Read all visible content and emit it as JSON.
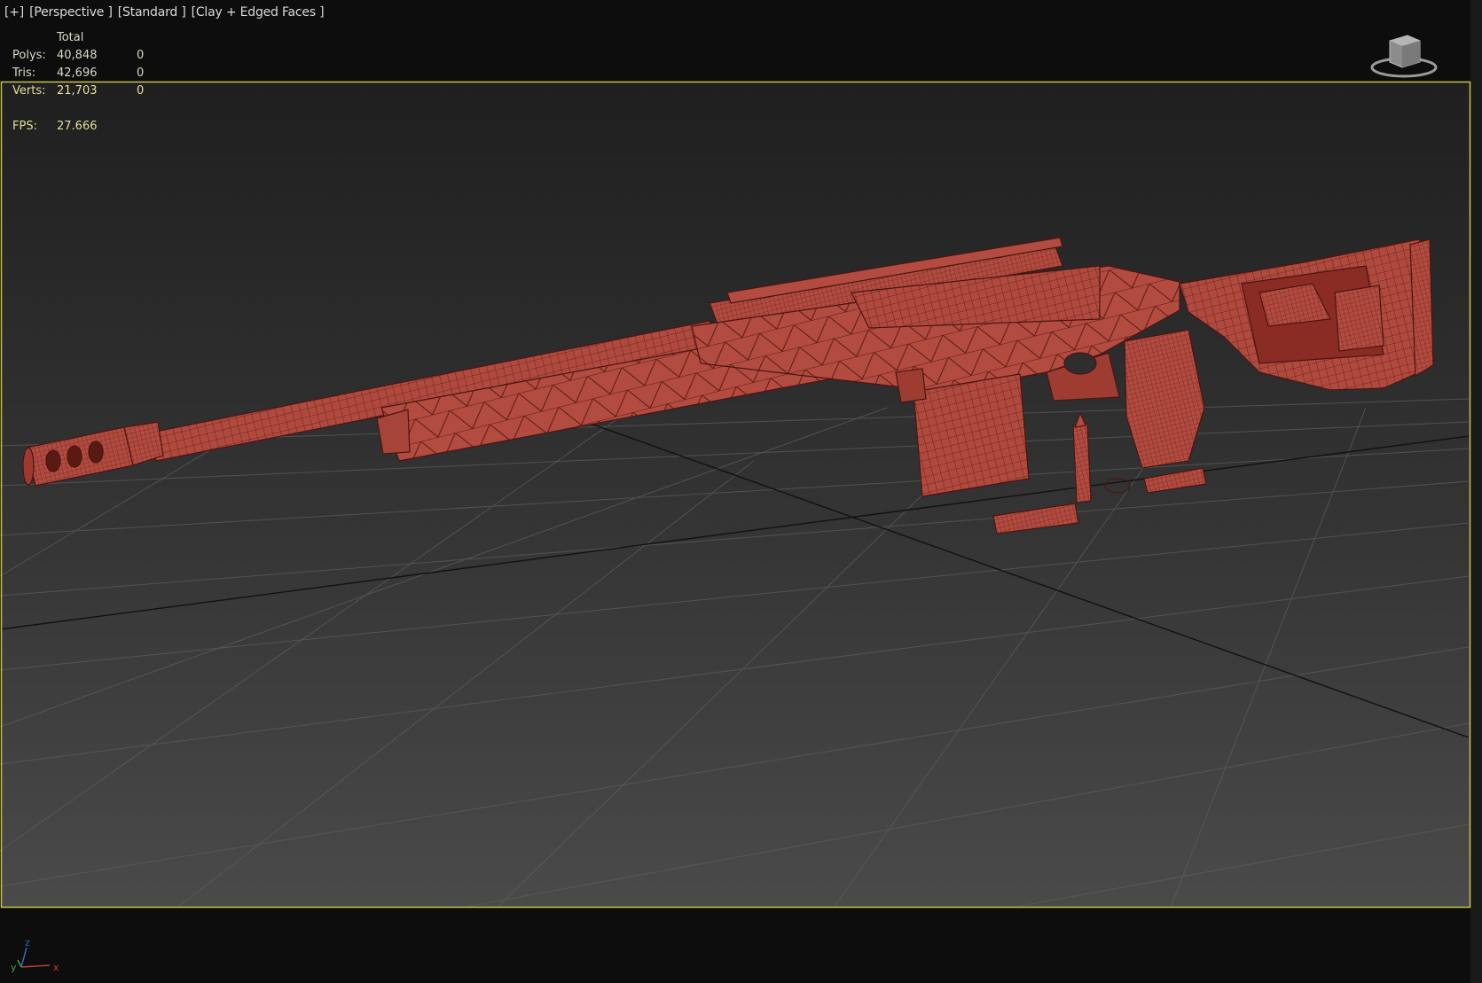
{
  "viewport": {
    "menu_label": "[+]",
    "view_label": "[Perspective ]",
    "shading_label": "[Standard ]",
    "style_label": "[Clay + Edged Faces ]"
  },
  "stats": {
    "header_total": "Total",
    "rows": [
      {
        "label": "Polys:",
        "total": "40,848",
        "selected": "0"
      },
      {
        "label": "Tris:",
        "total": "42,696",
        "selected": "0"
      },
      {
        "label": "Verts:",
        "total": "21,703",
        "selected": "0"
      }
    ],
    "fps_label": "FPS:",
    "fps_value": "27.666"
  },
  "axis": {
    "x": "x",
    "y": "y",
    "z": "z"
  },
  "colors": {
    "model_red": "#b5473c",
    "viewport_border": "#c8c34a",
    "grid_line": "#5c5c5c"
  },
  "icons": {
    "viewcube": "viewcube-icon",
    "axis_tripod": "axis-tripod-icon"
  }
}
